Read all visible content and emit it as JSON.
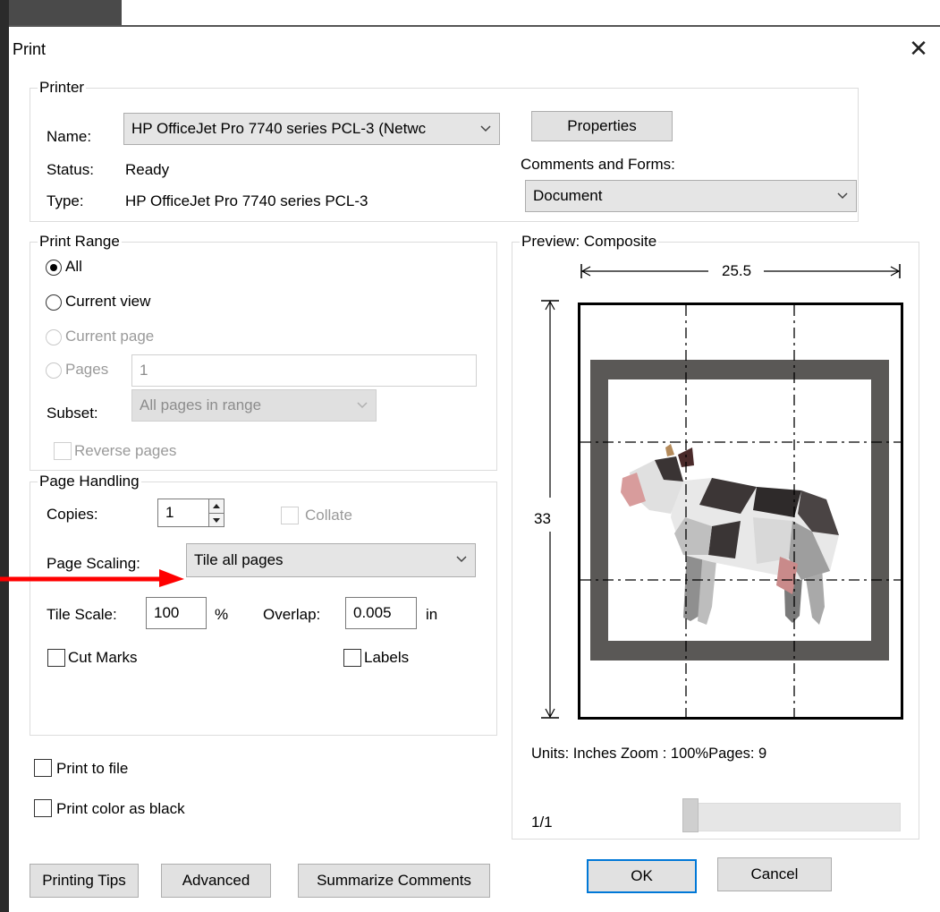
{
  "window": {
    "title": "Print",
    "close_glyph": "✕"
  },
  "printer": {
    "legend": "Printer",
    "name_label": "Name:",
    "name_value": "HP OfficeJet Pro 7740 series PCL-3 (Netwc",
    "status_label": "Status:",
    "status_value": "Ready",
    "type_label": "Type:",
    "type_value": "HP OfficeJet Pro 7740 series PCL-3",
    "properties_label": "Properties",
    "comments_label": "Comments and Forms:",
    "comments_value": "Document"
  },
  "print_range": {
    "legend": "Print Range",
    "all_label": "All",
    "current_view_label": "Current view",
    "current_page_label": "Current page",
    "pages_label": "Pages",
    "pages_value": "1",
    "subset_label": "Subset:",
    "subset_value": "All pages in range",
    "reverse_label": "Reverse pages",
    "selected": "All"
  },
  "page_handling": {
    "legend": "Page Handling",
    "copies_label": "Copies:",
    "copies_value": "1",
    "collate_label": "Collate",
    "scaling_label": "Page Scaling:",
    "scaling_value": "Tile all pages",
    "tile_scale_label": "Tile Scale:",
    "tile_scale_value": "100",
    "percent_label": "%",
    "overlap_label": "Overlap:",
    "overlap_value": "0.005",
    "overlap_unit": "in",
    "cut_marks_label": "Cut Marks",
    "labels_label": "Labels"
  },
  "options": {
    "print_to_file_label": "Print to file",
    "print_color_black_label": "Print color as black"
  },
  "preview": {
    "legend": "Preview: Composite",
    "width_value": "25.5",
    "height_value": "33",
    "info_text": "Units: Inches Zoom : 100%Pages: 9",
    "page_indicator": "1/1"
  },
  "buttons": {
    "printing_tips": "Printing Tips",
    "advanced": "Advanced",
    "summarize": "Summarize Comments",
    "ok": "OK",
    "cancel": "Cancel"
  },
  "colors": {
    "annotation_arrow": "#ff0000",
    "frame": "#5a5856",
    "default_button_border": "#0078d7"
  }
}
